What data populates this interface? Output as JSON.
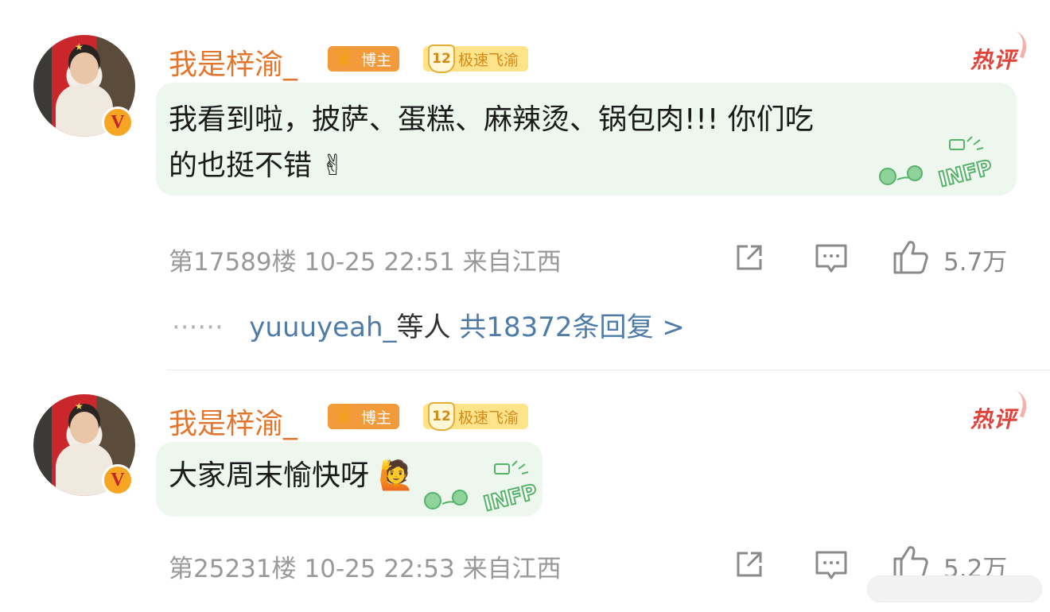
{
  "comments": [
    {
      "username": "我是梓渝_",
      "badge_blogger": "博主",
      "badge_fan_level": "12",
      "badge_fan_name": "极速飞渝",
      "hot_label": "热评",
      "text": "我看到啦，披萨、蛋糕、麻辣烫、锅包肉!!! 你们吃\n的也挺不错",
      "emoji": "✌",
      "sticker_text": "INFP",
      "meta": "第17589楼 10-25 22:51 来自江西",
      "likes": "5.7万",
      "replies": {
        "prefix": "······",
        "who": "yuuuyeah_",
        "and": "等人",
        "count": "共18372条回复 >"
      }
    },
    {
      "username": "我是梓渝_",
      "badge_blogger": "博主",
      "badge_fan_level": "12",
      "badge_fan_name": "极速飞渝",
      "hot_label": "热评",
      "text": "大家周末愉快呀",
      "emoji": "🙋",
      "sticker_text": "INFP",
      "meta": "第25231楼 10-25 22:53 来自江西",
      "likes": "5.2万"
    }
  ],
  "icons": {
    "share": "share-icon",
    "comment": "comment-icon",
    "like": "thumbs-up-icon",
    "verified": "verified-v-icon",
    "crown": "crown-icon"
  },
  "colors": {
    "username": "#e2762d",
    "hot": "#e0433b",
    "bubble": "#edf7ee",
    "link": "#4f7ba8",
    "meta": "#999999"
  }
}
